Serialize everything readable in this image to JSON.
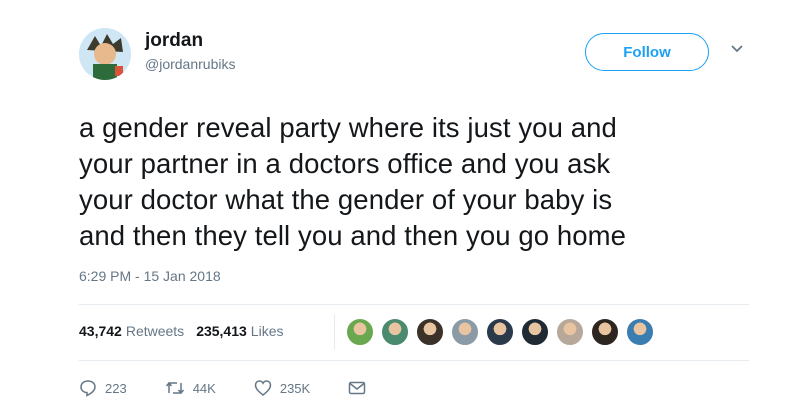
{
  "author": {
    "name": "jordan",
    "handle": "@jordanrubiks"
  },
  "follow_label": "Follow",
  "tweet": {
    "lines": [
      "a gender reveal party where its just you and",
      "your partner in a doctors office and you ask",
      "your doctor what the gender of your baby is",
      "and then they tell you and then you go home"
    ]
  },
  "timestamp": "6:29 PM - 15 Jan 2018",
  "stats": {
    "retweets_count": "43,742",
    "retweets_label": "Retweets",
    "likes_count": "235,413",
    "likes_label": "Likes"
  },
  "likers": [
    {
      "icon": "liker-avatar",
      "color": "#6aa84f"
    },
    {
      "icon": "liker-avatar",
      "color": "#4a8a6e"
    },
    {
      "icon": "liker-avatar",
      "color": "#3b3128"
    },
    {
      "icon": "liker-avatar",
      "color": "#8a9aa6"
    },
    {
      "icon": "liker-avatar",
      "color": "#2b3a4a"
    },
    {
      "icon": "liker-avatar",
      "color": "#1f2a33"
    },
    {
      "icon": "liker-avatar",
      "color": "#b8a89a"
    },
    {
      "icon": "liker-avatar",
      "color": "#2d2520"
    },
    {
      "icon": "liker-avatar",
      "color": "#3a7db0"
    }
  ],
  "actions": {
    "reply_count": "223",
    "retweet_count": "44K",
    "like_count": "235K"
  },
  "colors": {
    "accent": "#1da1f2",
    "muted": "#657786",
    "text": "#14171a"
  }
}
